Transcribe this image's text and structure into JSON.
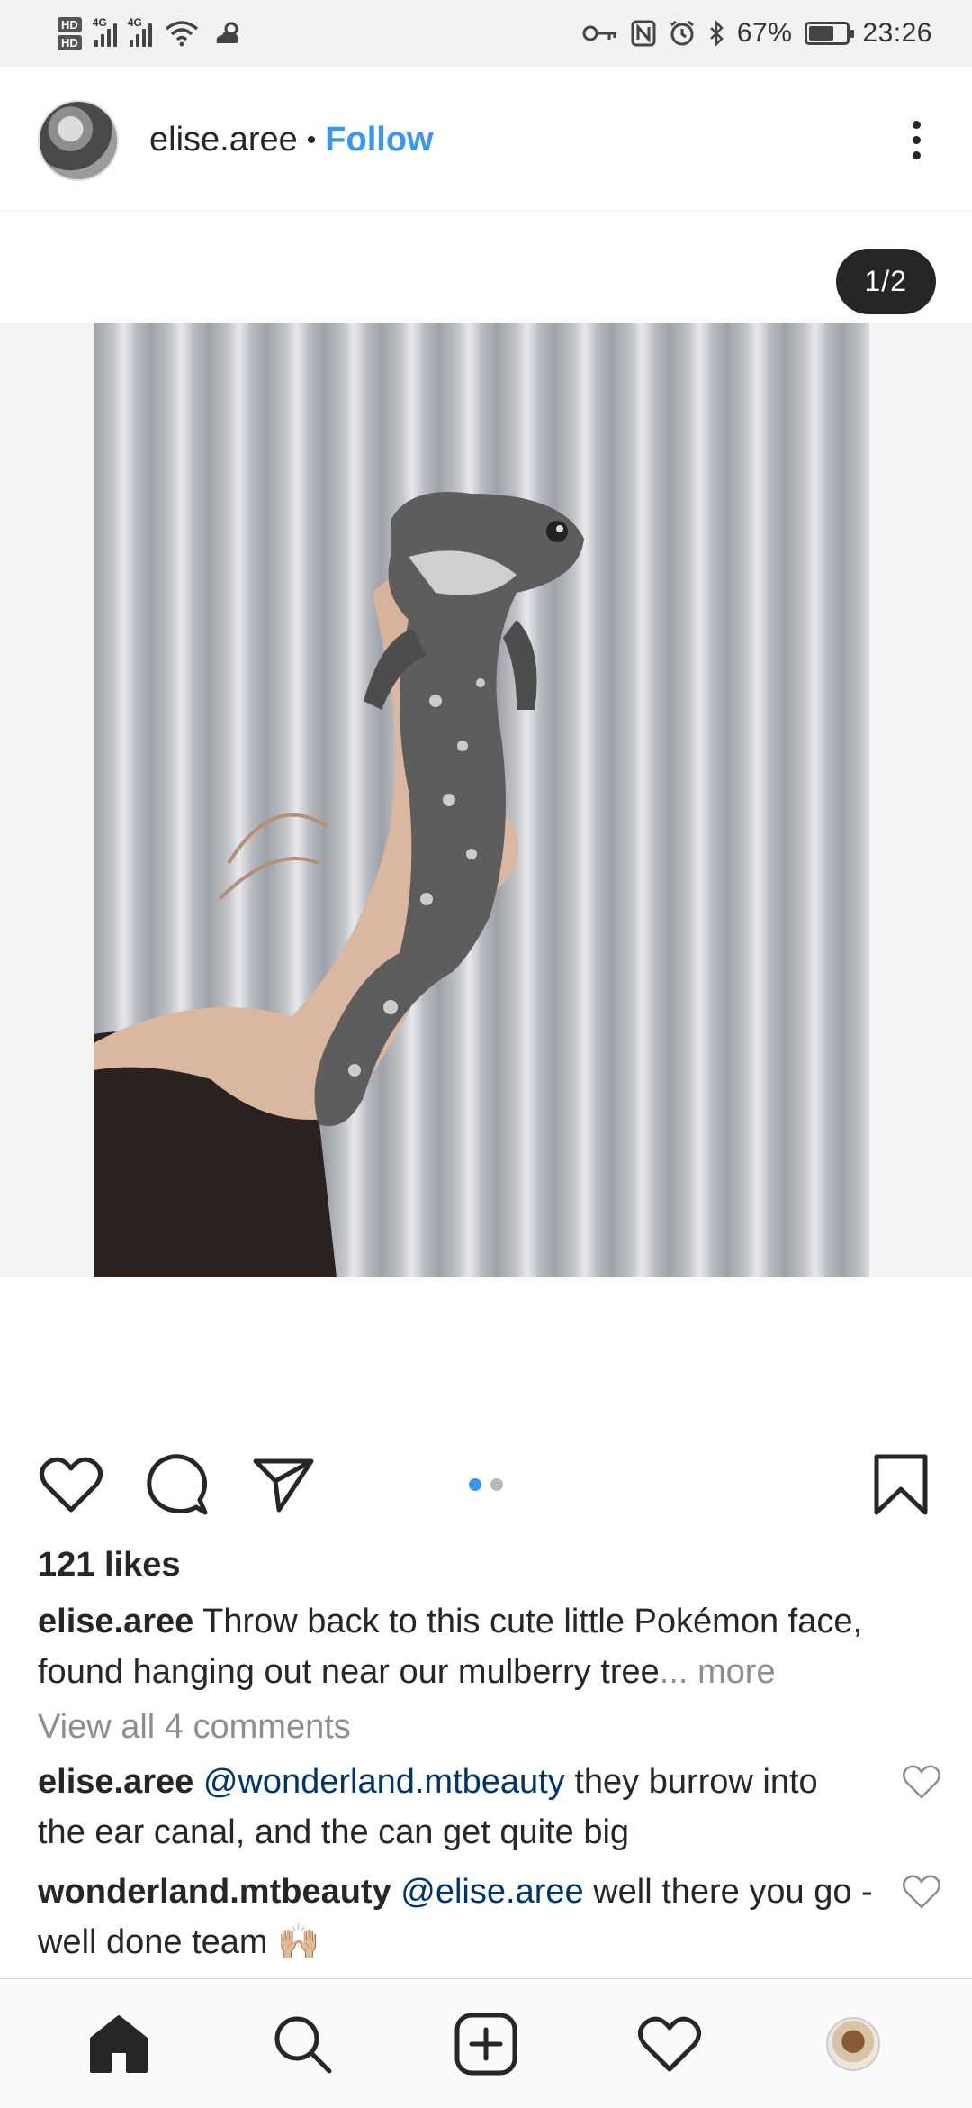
{
  "status_bar": {
    "hd1": "HD",
    "hd2": "HD",
    "net1": "4G",
    "net2": "4G",
    "battery_percent": "67%",
    "time": "23:26",
    "battery_level": 0.67,
    "icons": [
      "key-icon",
      "nfc-icon",
      "alarm-icon",
      "bluetooth-icon",
      "wifi-icon",
      "weather-icon"
    ]
  },
  "post": {
    "username": "elise.aree",
    "separator": "•",
    "follow_label": "Follow",
    "counter": "1/2",
    "carousel_index": 0,
    "carousel_total": 2,
    "likes": "121 likes",
    "caption_text": "Throw back to this cute little Pokémon face, found hanging out near our mulberry tree",
    "caption_more": "... more",
    "view_comments": "View all 4 comments"
  },
  "comments": [
    {
      "username": "elise.aree",
      "mention": "@wonderland.mtbeauty",
      "text": "they burrow into the ear canal, and the can get quite big"
    },
    {
      "username": "wonderland.mtbeauty",
      "mention": "@elise.aree",
      "text": " well there you go - well done team 🙌🏼"
    }
  ],
  "colors": {
    "accent": "#3897f0",
    "mention": "#003569",
    "text": "#262626",
    "muted": "#8e8e8e"
  },
  "nav": [
    "home-icon",
    "search-icon",
    "add-post-icon",
    "activity-heart-icon",
    "profile-avatar"
  ]
}
